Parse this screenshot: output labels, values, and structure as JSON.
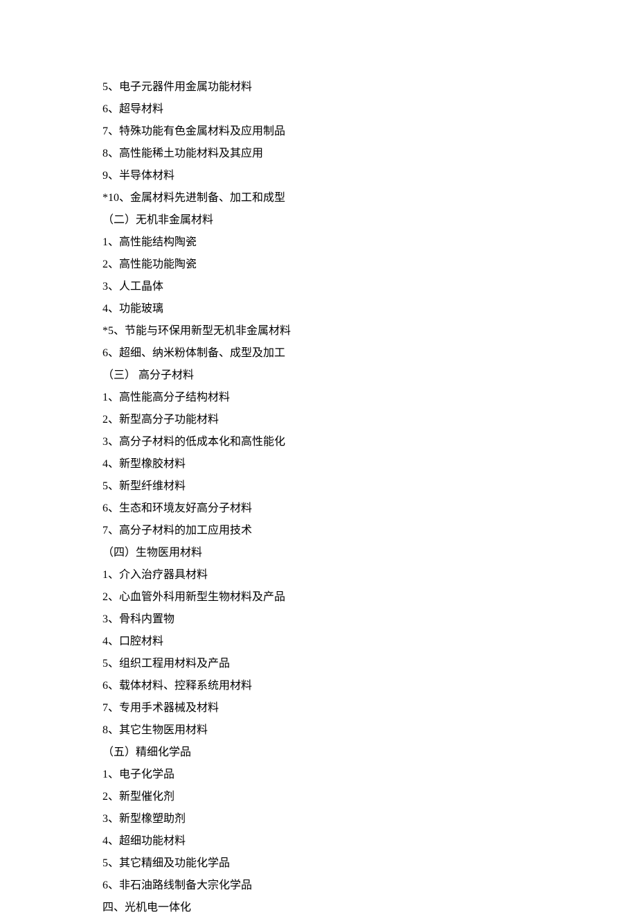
{
  "lines": [
    "5、电子元器件用金属功能材料",
    "6、超导材料",
    "7、特殊功能有色金属材料及应用制品",
    "8、高性能稀土功能材料及其应用",
    "9、半导体材料",
    "*10、金属材料先进制备、加工和成型",
    "（二）无机非金属材料",
    "1、高性能结构陶瓷",
    "2、高性能功能陶瓷",
    "3、人工晶体",
    "4、功能玻璃",
    "*5、节能与环保用新型无机非金属材料",
    "6、超细、纳米粉体制备、成型及加工",
    "（三） 高分子材料",
    "1、高性能高分子结构材料",
    "2、新型高分子功能材料",
    "3、高分子材料的低成本化和高性能化",
    "4、新型橡胶材料",
    "5、新型纤维材料",
    "6、生态和环境友好高分子材料",
    "7、高分子材料的加工应用技术",
    "（四）生物医用材料",
    "1、介入治疗器具材料",
    "2、心血管外科用新型生物材料及产品",
    "3、骨科内置物",
    "4、口腔材料",
    "5、组织工程用材料及产品",
    "6、载体材料、控释系统用材料",
    "7、专用手术器械及材料",
    "8、其它生物医用材料",
    "（五）精细化学品",
    "1、电子化学品",
    "2、新型催化剂",
    "3、新型橡塑助剂",
    "4、超细功能材料",
    "5、其它精细及功能化学品",
    "6、非石油路线制备大宗化学品",
    "四、光机电一体化"
  ]
}
